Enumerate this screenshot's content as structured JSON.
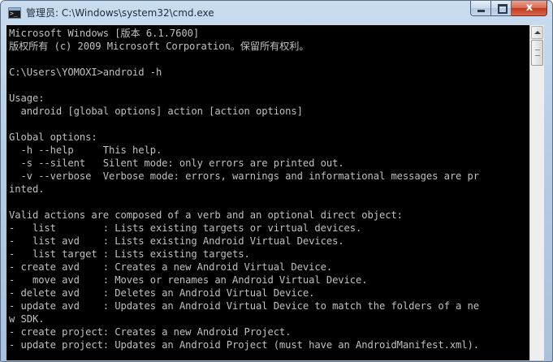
{
  "window": {
    "title": "管理员: C:\\Windows\\system32\\cmd.exe",
    "app_icon": "cmd-icon",
    "controls": {
      "minimize_icon": "minimize-icon",
      "maximize_icon": "maximize-icon",
      "close_icon": "close-icon",
      "close_glyph": "x"
    },
    "accent_color": "#b7cde4",
    "close_color": "#c2391c"
  },
  "console": {
    "background": "#000000",
    "foreground": "#c0c0c0",
    "lines": [
      "Microsoft Windows [版本 6.1.7600]",
      "版权所有 (c) 2009 Microsoft Corporation。保留所有权利。",
      "",
      "C:\\Users\\YOMOXI>android -h",
      "",
      "Usage:",
      "  android [global options] action [action options]",
      "",
      "Global options:",
      "  -h --help     This help.",
      "  -s --silent   Silent mode: only errors are printed out.",
      "  -v --verbose  Verbose mode: errors, warnings and informational messages are pr",
      "inted.",
      "",
      "Valid actions are composed of a verb and an optional direct object:",
      "-   list        : Lists existing targets or virtual devices.",
      "-   list avd    : Lists existing Android Virtual Devices.",
      "-   list target : Lists existing targets.",
      "- create avd    : Creates a new Android Virtual Device.",
      "-   move avd    : Moves or renames an Android Virtual Device.",
      "- delete avd    : Deletes an Android Virtual Device.",
      "- update avd    : Updates an Android Virtual Device to match the folders of a ne",
      "w SDK.",
      "- create project: Creates a new Android Project.",
      "- update project: Updates an Android Project (must have an AndroidManifest.xml)."
    ]
  },
  "scrollbar": {
    "up_arrow_icon": "scroll-up-arrow-icon",
    "thumb_icon": "scroll-thumb-grip-icon"
  }
}
